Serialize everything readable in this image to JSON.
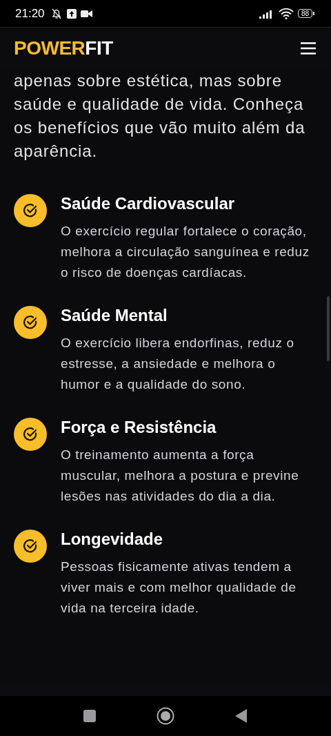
{
  "status_bar": {
    "time": "21:20",
    "battery": "88"
  },
  "header": {
    "logo_primary": "POWER",
    "logo_secondary": "FIT"
  },
  "intro": "apenas sobre estética, mas sobre saúde e qualidade de vida. Conheça os benefícios que vão muito além da aparência.",
  "benefits": [
    {
      "title": "Saúde Cardiovascular",
      "description": "O exercício regular fortalece o coração, melhora a circulação sanguínea e reduz o risco de doenças cardíacas."
    },
    {
      "title": "Saúde Mental",
      "description": "O exercício libera endorfinas, reduz o estresse, a ansiedade e melhora o humor e a qualidade do sono."
    },
    {
      "title": "Força e Resistência",
      "description": "O treinamento aumenta a força muscular, melhora a postura e previne lesões nas atividades do dia a dia."
    },
    {
      "title": "Longevidade",
      "description": "Pessoas fisicamente ativas tendem a viver mais e com melhor qualidade de vida na terceira idade."
    }
  ]
}
